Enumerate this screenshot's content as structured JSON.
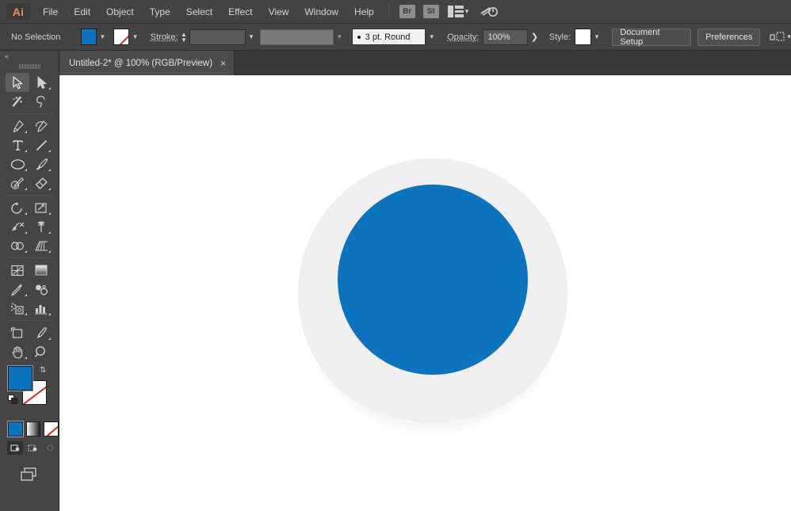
{
  "app": {
    "name": "Adobe Illustrator",
    "logo_text": "Ai"
  },
  "menubar": {
    "items": [
      {
        "label": "File"
      },
      {
        "label": "Edit"
      },
      {
        "label": "Object"
      },
      {
        "label": "Type"
      },
      {
        "label": "Select"
      },
      {
        "label": "Effect"
      },
      {
        "label": "View"
      },
      {
        "label": "Window"
      },
      {
        "label": "Help"
      }
    ],
    "bridge_label": "Br",
    "stock_label": "St",
    "arrange_icon": "arrange-documents-icon",
    "workspace_icon": "workspace-switcher-icon"
  },
  "controlbar": {
    "selection_status": "No Selection",
    "fill_color": "#0c74bf",
    "stroke_color": "none",
    "stroke_label": "Stroke:",
    "stroke_weight": "",
    "stroke_profile": "",
    "brush_preset": "3 pt. Round",
    "opacity_label": "Opacity:",
    "opacity_value": "100%",
    "style_label": "Style:",
    "style_swatch": "#f2f2f2",
    "document_setup_label": "Document Setup",
    "preferences_label": "Preferences",
    "align_icon": "align-to-artboard-icon"
  },
  "tabbar": {
    "tab_title": "Untitled-2* @ 100% (RGB/Preview)",
    "close_label": "×"
  },
  "toolbar": {
    "collapse_label": "«",
    "tools": [
      {
        "name": "selection-tool",
        "active": true,
        "corner": false
      },
      {
        "name": "direct-selection-tool",
        "active": false,
        "corner": true
      },
      {
        "name": "magic-wand-tool",
        "active": false,
        "corner": false
      },
      {
        "name": "lasso-tool",
        "active": false,
        "corner": false
      },
      {
        "name": "pen-tool",
        "active": false,
        "corner": true
      },
      {
        "name": "curvature-tool",
        "active": false,
        "corner": false
      },
      {
        "name": "type-tool",
        "active": false,
        "corner": true
      },
      {
        "name": "line-segment-tool",
        "active": false,
        "corner": true
      },
      {
        "name": "ellipse-tool",
        "active": false,
        "corner": true
      },
      {
        "name": "paintbrush-tool",
        "active": false,
        "corner": true
      },
      {
        "name": "shaper-tool",
        "active": false,
        "corner": true
      },
      {
        "name": "eraser-tool",
        "active": false,
        "corner": true
      },
      {
        "name": "rotate-tool",
        "active": false,
        "corner": true
      },
      {
        "name": "scale-tool",
        "active": false,
        "corner": true
      },
      {
        "name": "width-tool",
        "active": false,
        "corner": true
      },
      {
        "name": "free-transform-tool",
        "active": false,
        "corner": true
      },
      {
        "name": "shape-builder-tool",
        "active": false,
        "corner": true
      },
      {
        "name": "perspective-grid-tool",
        "active": false,
        "corner": true
      },
      {
        "name": "mesh-tool",
        "active": false,
        "corner": false
      },
      {
        "name": "gradient-tool",
        "active": false,
        "corner": false
      },
      {
        "name": "eyedropper-tool",
        "active": false,
        "corner": true
      },
      {
        "name": "blend-tool",
        "active": false,
        "corner": false
      },
      {
        "name": "symbol-sprayer-tool",
        "active": false,
        "corner": true
      },
      {
        "name": "column-graph-tool",
        "active": false,
        "corner": true
      },
      {
        "name": "artboard-tool",
        "active": false,
        "corner": false
      },
      {
        "name": "slice-tool",
        "active": false,
        "corner": true
      },
      {
        "name": "hand-tool",
        "active": false,
        "corner": true
      },
      {
        "name": "zoom-tool",
        "active": false,
        "corner": false
      }
    ],
    "fill_color": "#0c74bf",
    "stroke_color": "none",
    "swap_icon": "swap-fill-stroke-icon",
    "default_icon": "default-fill-stroke-icon",
    "mode_color_label": "color-mode-button",
    "mode_gradient_label": "gradient-mode-button",
    "mode_none_label": "none-mode-button",
    "draw_normal": "draw-normal-button",
    "draw_behind": "draw-behind-button",
    "draw_inside": "draw-inside-button",
    "screen_mode": "change-screen-mode-button"
  },
  "artwork": {
    "description": "crystal-ball illustration",
    "sphere_color": "#efefef",
    "sphere_shadow_color": "#e8e8e8",
    "lens_color": "#0c74bf",
    "base_color": "#efefef",
    "base_shadow_color": "#c9c9c9",
    "band_color": "#f6f6f6"
  }
}
